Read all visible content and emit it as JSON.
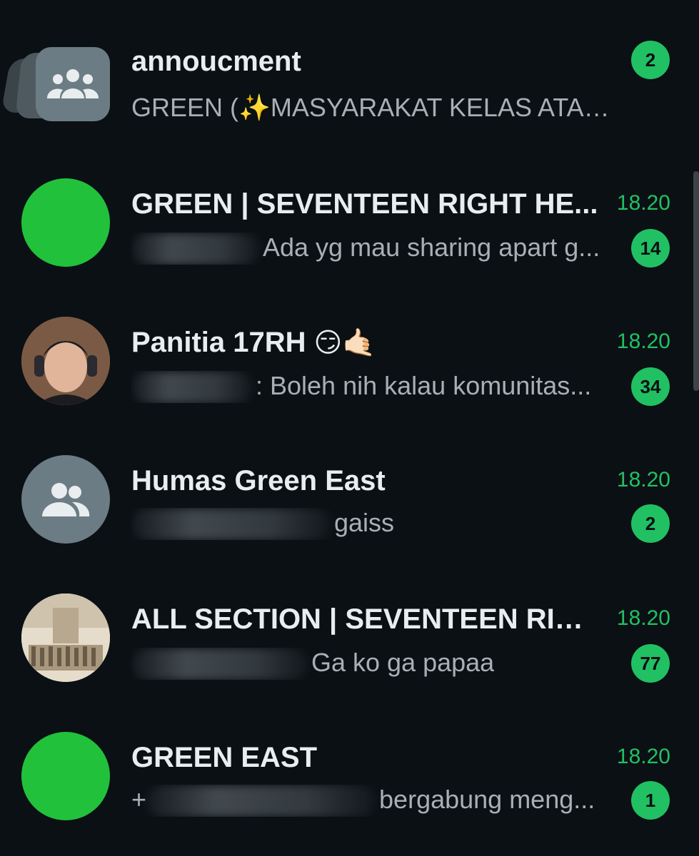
{
  "chats": [
    {
      "title": "annoucment",
      "preview": "GREEN (✨MASYARAKAT KELAS ATAS✨)...",
      "time": "",
      "unread": "2",
      "avatar": "community-group-icon"
    },
    {
      "title": "GREEN | SEVENTEEN RIGHT HE...",
      "preview": "Ada yg mau sharing apart g...",
      "time": "18.20",
      "unread": "14",
      "avatar": "green-circle"
    },
    {
      "title": "Panitia 17RH",
      "title_emoji": "😏🤙🏻",
      "preview": ": Boleh nih kalau komunitas...",
      "time": "18.20",
      "unread": "34",
      "avatar": "person-photo"
    },
    {
      "title": "Humas Green East",
      "preview": "gaiss",
      "time": "18.20",
      "unread": "2",
      "avatar": "group-icon"
    },
    {
      "title": "ALL SECTION | SEVENTEEN RIG...",
      "preview": "Ga ko ga papaa",
      "time": "18.20",
      "unread": "77",
      "avatar": "group-photo"
    },
    {
      "title": "GREEN EAST",
      "preview_prefix": "+",
      "preview": "bergabung meng...",
      "time": "18.20",
      "unread": "1",
      "avatar": "green-circle"
    }
  ],
  "colors": {
    "background": "#0b1014",
    "accent": "#21c063",
    "avatar_green": "#22c13c",
    "avatar_grey": "#6b7c85"
  }
}
